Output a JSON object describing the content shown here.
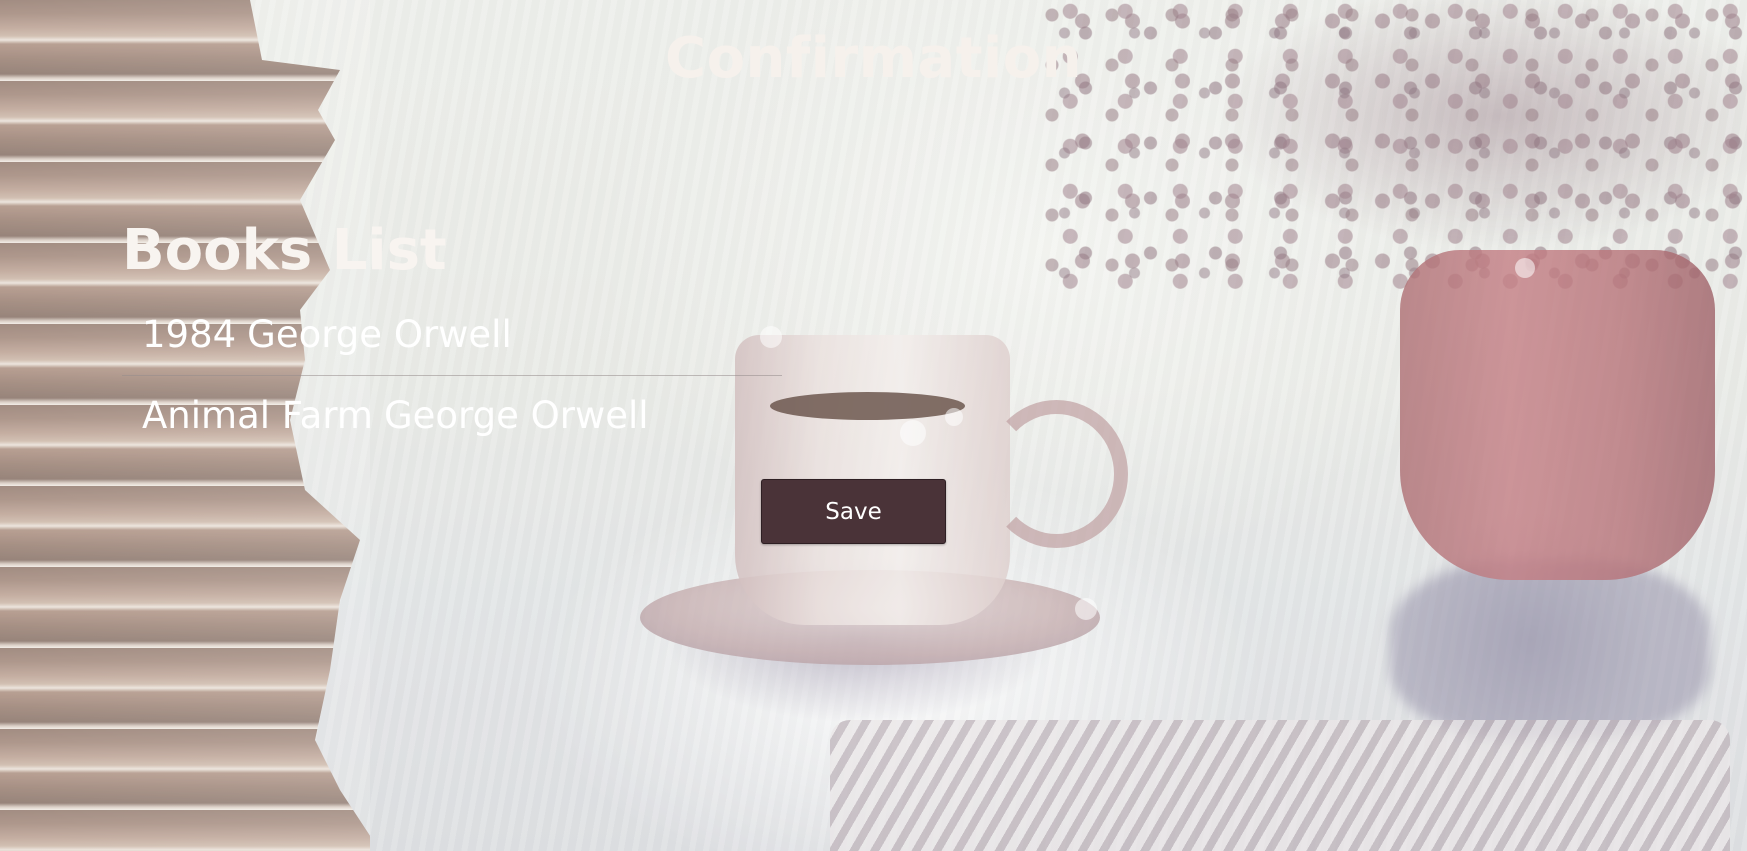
{
  "page": {
    "title": "Confirmation"
  },
  "books_list": {
    "heading": "Books List",
    "items": [
      {
        "title": "1984",
        "author": "George Orwell"
      },
      {
        "title": "Animal Farm",
        "author": "George Orwell"
      }
    ]
  },
  "actions": {
    "save_label": "Save"
  },
  "colors": {
    "button_bg": "#4a3338",
    "heading_text": "#f6f1ec"
  }
}
